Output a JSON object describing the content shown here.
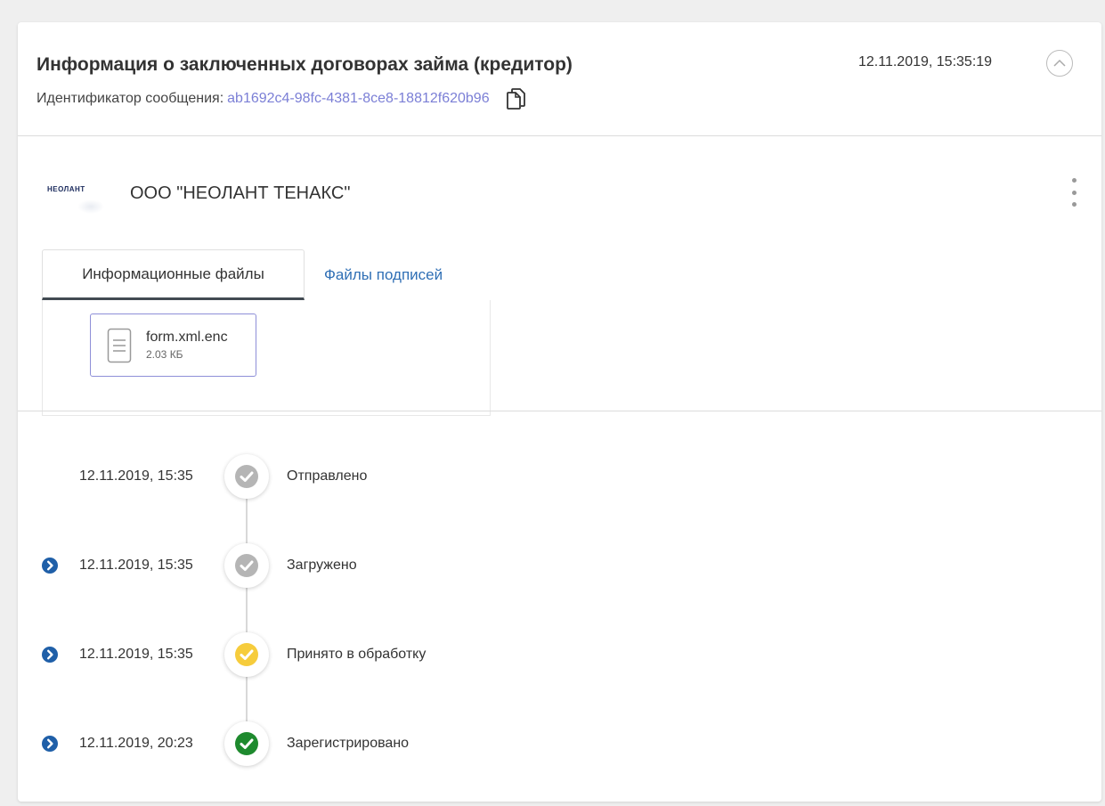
{
  "header": {
    "title": "Информация о заключенных договорах займа (кредитор)",
    "msgid_label": "Идентификатор сообщения:",
    "msgid_value": "ab1692c4-98fc-4381-8ce8-18812f620b96",
    "date": "12.11.2019, 15:35:19"
  },
  "org": {
    "logo_text": "НЕОЛАНТ",
    "name": "ООО \"НЕОЛАНТ ТЕНАКС\""
  },
  "tabs": [
    {
      "label": "Информационные файлы",
      "active": true
    },
    {
      "label": "Файлы подписей",
      "active": false
    }
  ],
  "files": [
    {
      "name": "form.xml.enc",
      "size": "2.03 КБ"
    }
  ],
  "timeline": [
    {
      "date": "12.11.2019, 15:35",
      "status": "Отправлено",
      "color": "#b5b5b5",
      "expandable": false
    },
    {
      "date": "12.11.2019, 15:35",
      "status": "Загружено",
      "color": "#b5b5b5",
      "expandable": true
    },
    {
      "date": "12.11.2019, 15:35",
      "status": "Принято в обработку",
      "color": "#f6cc3c",
      "expandable": true
    },
    {
      "date": "12.11.2019, 20:23",
      "status": "Зарегистрировано",
      "color": "#1e8a2e",
      "expandable": true
    }
  ],
  "colors": {
    "accent_link": "#2f6fb5",
    "msgid": "#7b7fd6",
    "file_border": "#8e8fd8",
    "arrow": "#1f5fa8"
  }
}
